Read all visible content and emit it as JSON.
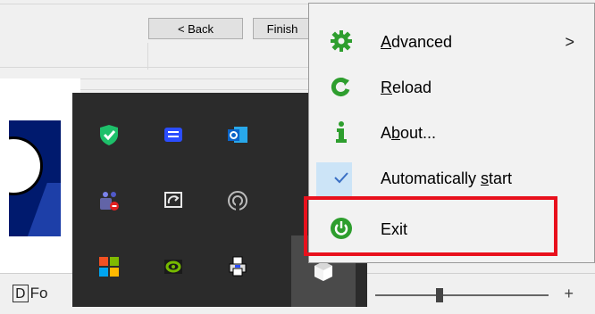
{
  "wizard": {
    "back_label": "< Back",
    "finish_label": "Finish"
  },
  "status_bar": {
    "fo_text": "Fo",
    "zoom_minus": "-",
    "zoom_plus": "+"
  },
  "tray": {
    "icons": [
      {
        "name": "shield-check-icon",
        "color": "#1ec06a"
      },
      {
        "name": "stack-app-icon",
        "color": "#2b4dff"
      },
      {
        "name": "outlook-icon",
        "color": "#0a64c8"
      },
      {
        "name": "teams-icon",
        "color": "#6264a7"
      },
      {
        "name": "sync-icon",
        "color": "#e8e8e8"
      },
      {
        "name": "hotspot-icon",
        "color": "#bbbbbb"
      },
      {
        "name": "microsoft-icon",
        "color": "#f25022"
      },
      {
        "name": "nvidia-icon",
        "color": "#76b900"
      },
      {
        "name": "network-printer-icon",
        "color": "#3a3a3a"
      },
      {
        "name": "app-cube-icon",
        "color": "#ffffff"
      }
    ]
  },
  "menu": {
    "items": [
      {
        "label_pre": "",
        "label_u": "A",
        "label_post": "dvanced",
        "icon": "gear-icon",
        "color": "#2e9e2e",
        "submenu": ">"
      },
      {
        "label_pre": "",
        "label_u": "R",
        "label_post": "eload",
        "icon": "reload-icon",
        "color": "#2e9e2e"
      },
      {
        "label_pre": "A",
        "label_u": "b",
        "label_post": "out...",
        "icon": "info-icon",
        "color": "#2e9e2e"
      },
      {
        "label_pre": "Automatically ",
        "label_u": "s",
        "label_post": "tart",
        "icon": "check-icon",
        "color": "#3a6fc4",
        "checked": true
      },
      {
        "label_pre": "E",
        "label_u": "",
        "label_post": "xit",
        "icon": "power-icon",
        "color": "#2e9e2e"
      }
    ]
  },
  "highlight_color": "#e8101c"
}
